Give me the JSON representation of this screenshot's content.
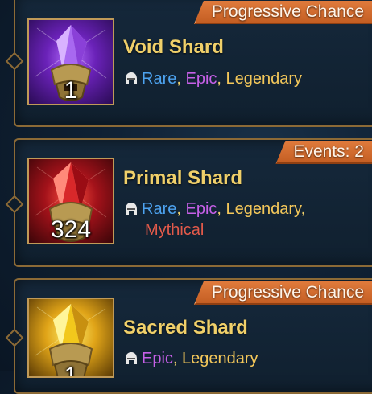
{
  "colors": {
    "rare": "#4da3f0",
    "epic": "#c760e8",
    "legendary": "#f3c75a",
    "mythical": "#e35a4a",
    "badge": "#d56b2e",
    "title": "#f0d06a"
  },
  "shards": [
    {
      "badge": "Progressive Chance",
      "name": "Void Shard",
      "count": "1",
      "rarities": [
        "Rare",
        "Epic",
        "Legendary"
      ],
      "rarity_icon": "champion-helmet-icon",
      "shard_color": "purple"
    },
    {
      "badge": "Events: 2",
      "name": "Primal Shard",
      "count": "324",
      "rarities": [
        "Rare",
        "Epic",
        "Legendary",
        "Mythical"
      ],
      "rarity_icon": "champion-helmet-icon",
      "shard_color": "red"
    },
    {
      "badge": "Progressive Chance",
      "name": "Sacred Shard",
      "count": "1",
      "rarities": [
        "Epic",
        "Legendary"
      ],
      "rarity_icon": "champion-helmet-icon",
      "shard_color": "gold"
    }
  ],
  "separators": [
    ",",
    ","
  ]
}
